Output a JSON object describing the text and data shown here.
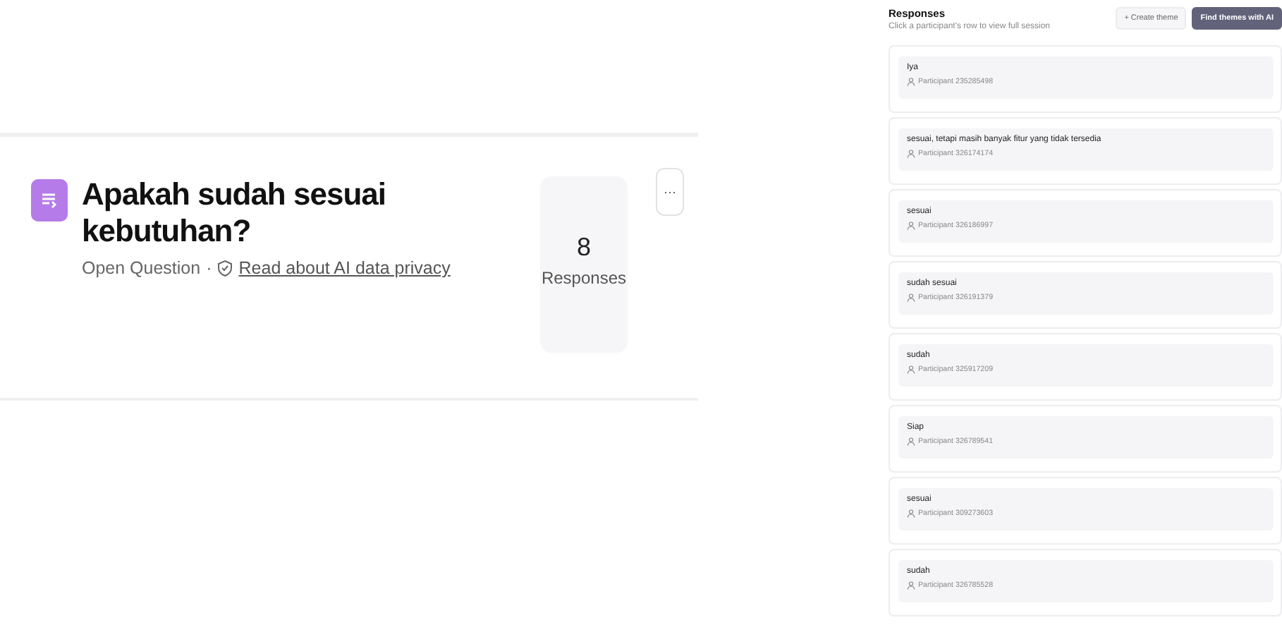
{
  "question": {
    "title": "Apakah sudah sesuai kebutuhan?",
    "type": "Open Question",
    "separator": "·",
    "privacy_link": "Read about AI data privacy",
    "count": "8",
    "count_label": "Responses",
    "more": "···"
  },
  "responses_panel": {
    "title": "Responses",
    "subtitle": "Click a participant's row to view full session",
    "buttons": [
      {
        "label": "+ Create theme",
        "kind": "secondary"
      },
      {
        "label": "Find themes with AI",
        "kind": "primary"
      }
    ],
    "responses": [
      {
        "text": "Iya",
        "participant": "Participant 235285498"
      },
      {
        "text": "sesuai, tetapi masih banyak fitur yang tidak tersedia",
        "participant": "Participant 326174174"
      },
      {
        "text": "sesuai",
        "participant": "Participant 326186997"
      },
      {
        "text": "sudah sesuai",
        "participant": "Participant 326191379"
      },
      {
        "text": "sudah",
        "participant": "Participant 325917209"
      },
      {
        "text": "Siap",
        "participant": "Participant 326789541"
      },
      {
        "text": "sesuai",
        "participant": "Participant 309273603"
      },
      {
        "text": "sudah",
        "participant": "Participant 326785528"
      }
    ]
  }
}
